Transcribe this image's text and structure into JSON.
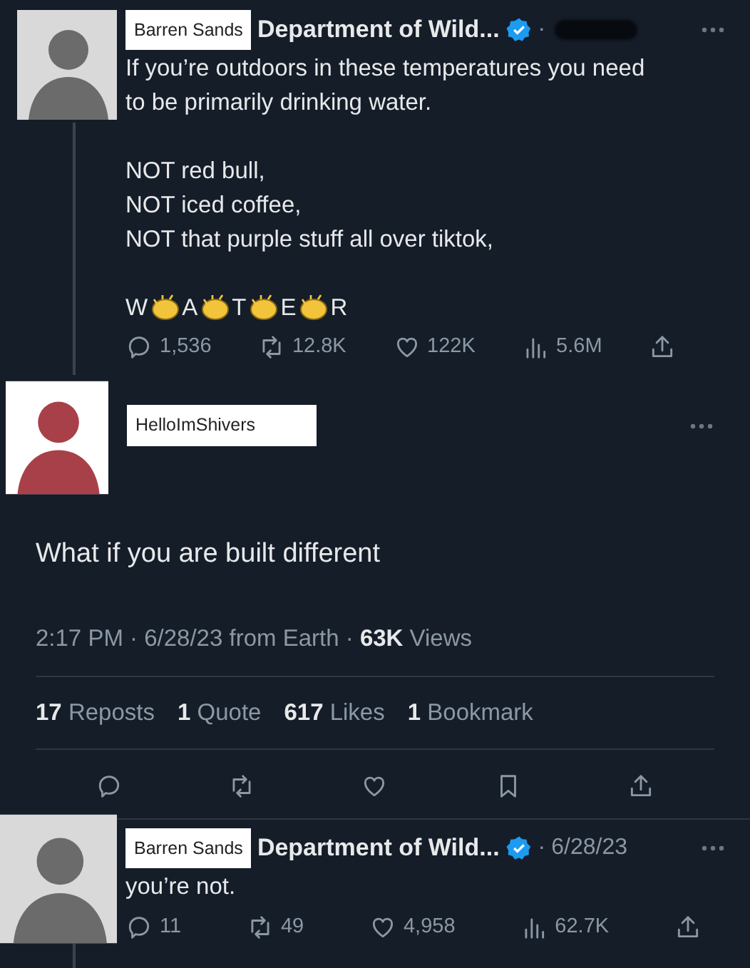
{
  "parent_tweet": {
    "display_name": "Barren Sands",
    "account_name": "Department of Wild...",
    "verified": true,
    "separator": "·",
    "handle_redacted": true,
    "paragraphs": [
      [
        "If you’re outdoors in these temperatures you need",
        "to be primarily drinking water."
      ],
      [
        "NOT red bull,",
        "NOT iced coffee,",
        "NOT that purple stuff all over tiktok,"
      ]
    ],
    "clap_letters": [
      "W",
      "A",
      "T",
      "E",
      "R"
    ],
    "actions": [
      {
        "kind": "reply",
        "count": "1,536"
      },
      {
        "kind": "repost",
        "count": "12.8K"
      },
      {
        "kind": "like",
        "count": "122K"
      },
      {
        "kind": "views",
        "count": "5.6M"
      },
      {
        "kind": "share"
      }
    ]
  },
  "main_tweet": {
    "display_name": "HelloImShivers",
    "text": "What if you are built different",
    "meta": "2:17 PM · 6/28/23 from Earth · **63K** Views",
    "stats": [
      "**17** Reposts",
      "**1** Quote",
      "**617** Likes",
      "**1** Bookmark"
    ],
    "actions": [
      {
        "kind": "reply"
      },
      {
        "kind": "repost"
      },
      {
        "kind": "like"
      },
      {
        "kind": "bookmark"
      },
      {
        "kind": "share"
      }
    ]
  },
  "reply_tweet": {
    "display_name": "Barren Sands",
    "account_name": "Department of Wild...",
    "verified": true,
    "separator": "·",
    "date": "6/28/23",
    "text": "you’re not.",
    "actions": [
      {
        "kind": "reply",
        "count": "11"
      },
      {
        "kind": "repost",
        "count": "49"
      },
      {
        "kind": "like",
        "count": "4,958"
      },
      {
        "kind": "views",
        "count": "62.7K"
      },
      {
        "kind": "share"
      }
    ]
  }
}
